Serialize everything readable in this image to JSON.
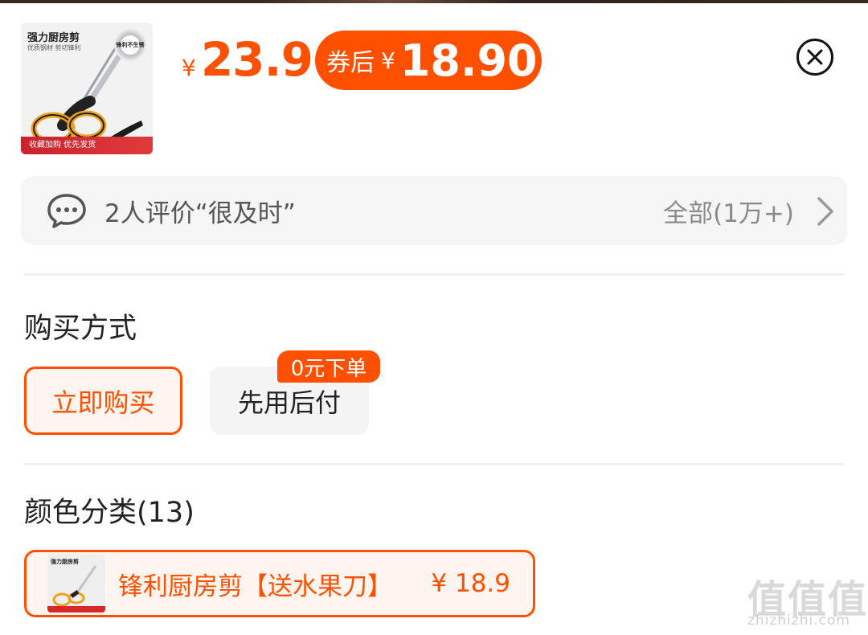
{
  "product": {
    "thumb_title": "强力厨房剪",
    "thumb_subtitle": "优质钢材 剪切锋利",
    "thumb_badge": "锋利不生锈",
    "thumb_bottom": "收藏加购 优先发货",
    "currency": "¥",
    "price": "23.9",
    "coupon_label": "券后",
    "coupon_price": "18.90"
  },
  "review": {
    "summary": "2人评价“很及时”",
    "all_label": "全部(1万+)"
  },
  "purchase": {
    "title": "购买方式",
    "buy_now": "立即购买",
    "pay_later": "先用后付",
    "pay_later_tag": "0元下单"
  },
  "variants": {
    "title": "颜色分类(13)",
    "selected": {
      "thumb_title": "强力厨房剪",
      "name": "锋利厨房剪【送水果刀】",
      "price": "¥ 18.9"
    }
  },
  "watermark": {
    "logo": "值值值",
    "site": "zhizhizhi.com"
  },
  "colors": {
    "accent": "#ff5000",
    "chip_bg": "#f5f5f5"
  },
  "icons": [
    "close-icon",
    "chat-icon",
    "chevron-right-icon"
  ]
}
